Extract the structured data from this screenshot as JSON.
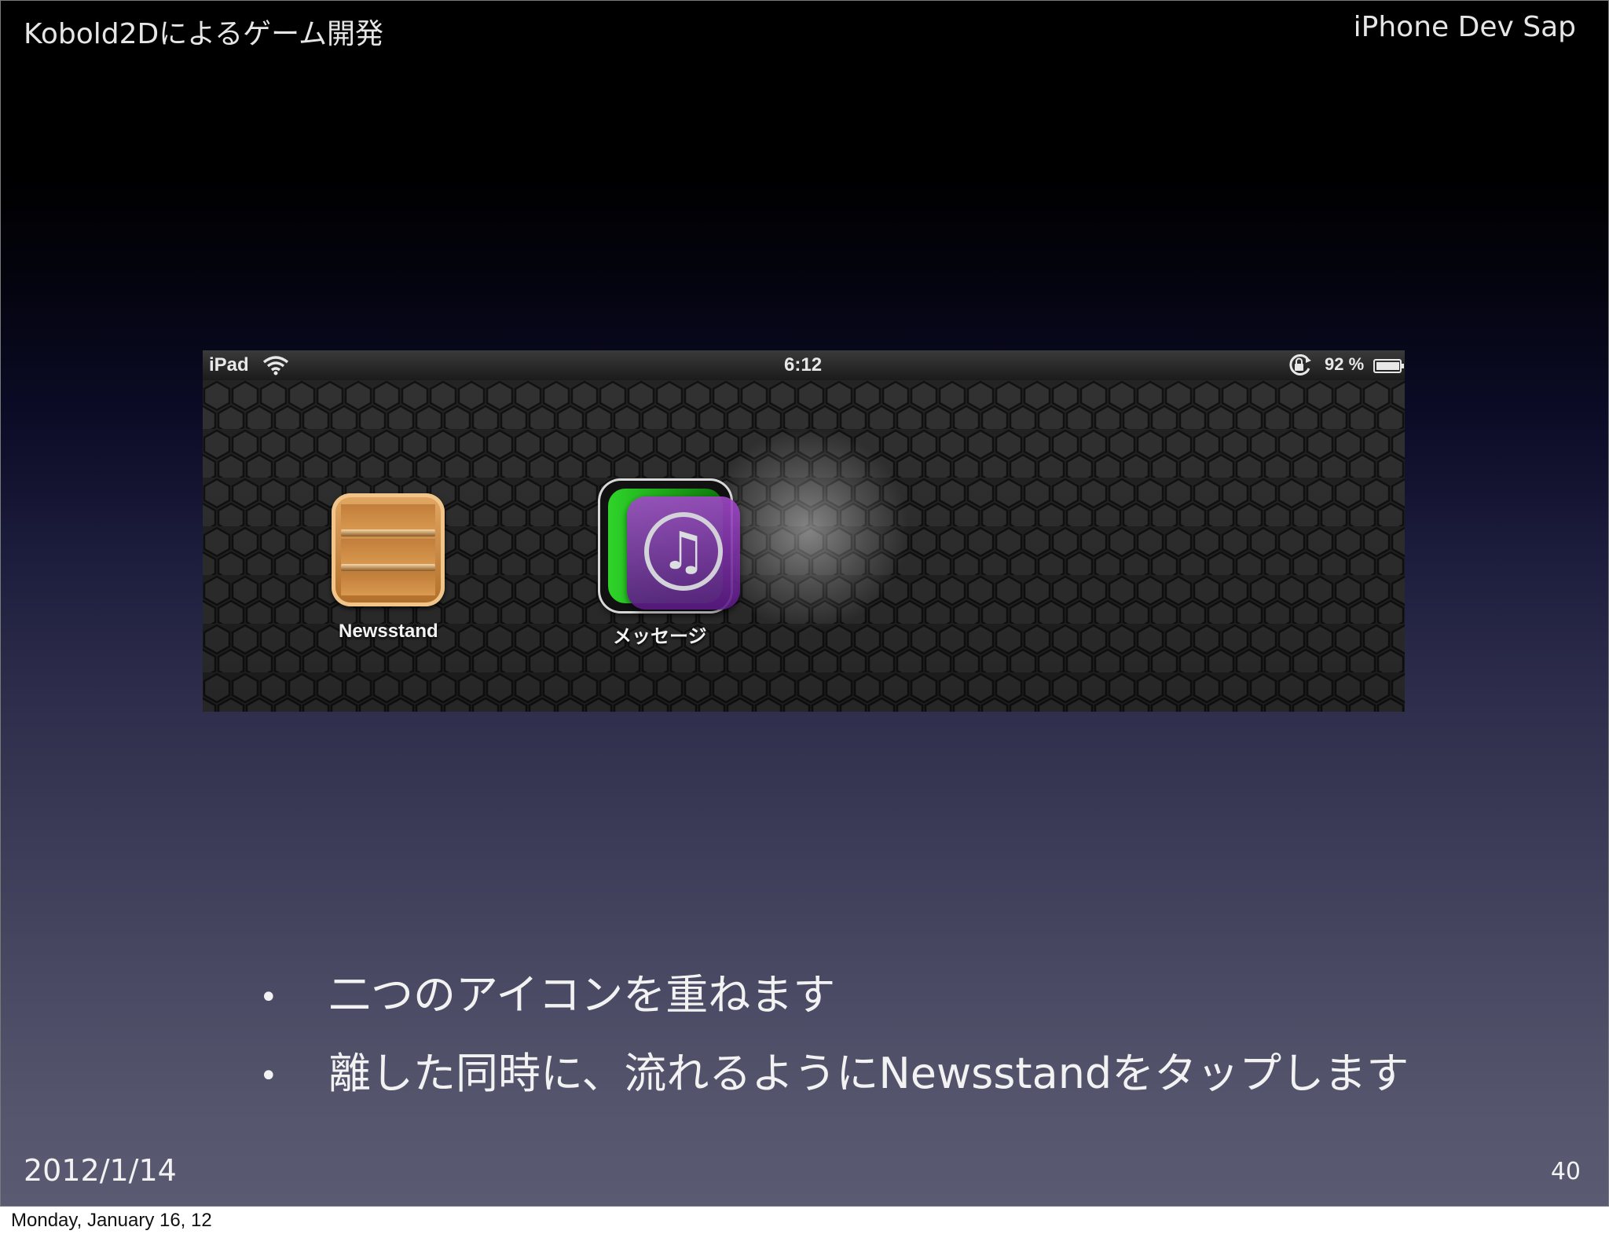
{
  "slide": {
    "header_left": "Kobold2Dによるゲーム開発",
    "header_right": "iPhone Dev Sap",
    "footer_date": "2012/1/14",
    "page_number": "40"
  },
  "screenshot": {
    "status_bar": {
      "device": "iPad",
      "time": "6:12",
      "battery": "92 %",
      "icons": [
        "wifi-icon",
        "rotation-lock-icon",
        "battery-icon"
      ]
    },
    "apps": [
      {
        "label": "Newsstand",
        "icon": "newsstand-shelf-icon"
      },
      {
        "label": "メッセージ",
        "icon": "messages-icon"
      }
    ],
    "dragged_icon": "itunes-music-note-icon",
    "colors": {
      "wallpaper": "#2a2a2a",
      "messages_green": "#2fd42a",
      "itunes_purple": "#8a3cb8",
      "newsstand_wood": "#d69a55"
    }
  },
  "bullets": [
    "二つのアイコンを重ねます",
    "離した同時に、流れるようにNewsstandをタップします"
  ],
  "caption": "Monday, January 16, 12"
}
